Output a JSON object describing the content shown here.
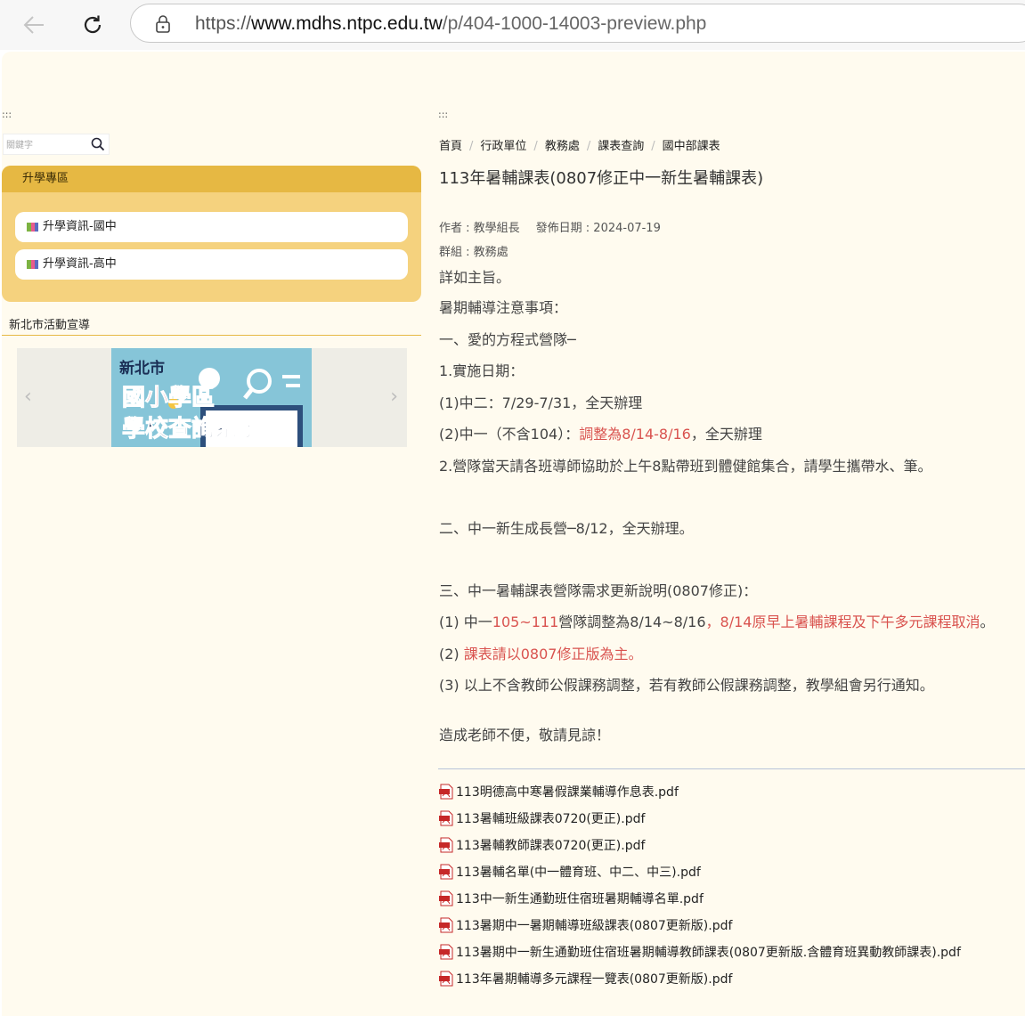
{
  "browser": {
    "url_scheme": "https://",
    "url_host": "www.mdhs.ntpc.edu.tw",
    "url_path": "/p/404-1000-14003-preview.php"
  },
  "anchors": {
    "left": ":::",
    "right": ":::"
  },
  "sidebar": {
    "search_placeholder": "關鍵字",
    "panel_title": "升學專區",
    "panel_items": [
      "升學資訊-國中",
      "升學資訊-高中"
    ],
    "promo_title": "新北市活動宣導",
    "banner": {
      "line1": "新北市",
      "line2": "國小學區",
      "line3": "學校查詢系統"
    }
  },
  "breadcrumb": [
    "首頁",
    "行政單位",
    "教務處",
    "課表查詢",
    "國中部課表"
  ],
  "article": {
    "title": "113年暑輔課表(0807修正中一新生暑輔課表)",
    "author": "作者 : 教學組長",
    "date": "發佈日期 : 2024-07-19",
    "group": "群組 : 教務處",
    "lines": {
      "l1": "詳如主旨。",
      "l2": "暑期輔導注意事項：",
      "l3": "一、愛的方程式營隊─",
      "l4": "1.實施日期：",
      "l5": "(1)中二：7/29-7/31，全天辦理",
      "l6a": "(2)中一（不含104）：",
      "l6b": "調整為8/14-8/16",
      "l6c": "，全天辦理",
      "l7": "2.營隊當天請各班導師協助於上午8點帶班到體健館集合，請學生攜帶水、筆。",
      "l8": "二、中一新生成長營─8/12，全天辦理。",
      "l9": "三、中一暑輔課表營隊需求更新說明(0807修正)：",
      "l10a": "(1) 中一",
      "l10b": "105~111",
      "l10c": "營隊調整為8/14~8/16",
      "l10d": "，8/14原早上暑輔課程及下午多元課程取消",
      "l10e": "。",
      "l11a": "(2) ",
      "l11b": "課表請以0807修正版為主。",
      "l12": "(3) 以上不含教師公假課務調整，若有教師公假課務調整，教學組會另行通知。",
      "l13": "造成老師不便，敬請見諒！"
    }
  },
  "attachments": [
    "113明德高中寒暑假課業輔導作息表.pdf",
    "113暑輔班級課表0720(更正).pdf",
    "113暑輔教師課表0720(更正).pdf",
    "113暑輔名單(中一體育班、中二、中三).pdf",
    "113中一新生通勤班住宿班暑期輔導名單.pdf",
    "113暑期中一暑期輔導班級課表(0807更新版).pdf",
    "113暑期中一新生通勤班住宿班暑期輔導教師課表(0807更新版.含體育班異動教師課表).pdf",
    "113年暑期輔導多元課程一覽表(0807更新版).pdf"
  ],
  "colors": {
    "accent": "#e6b843",
    "panel": "#f5d27e",
    "page_bg": "#fffbef",
    "highlight": "#d9534f"
  }
}
